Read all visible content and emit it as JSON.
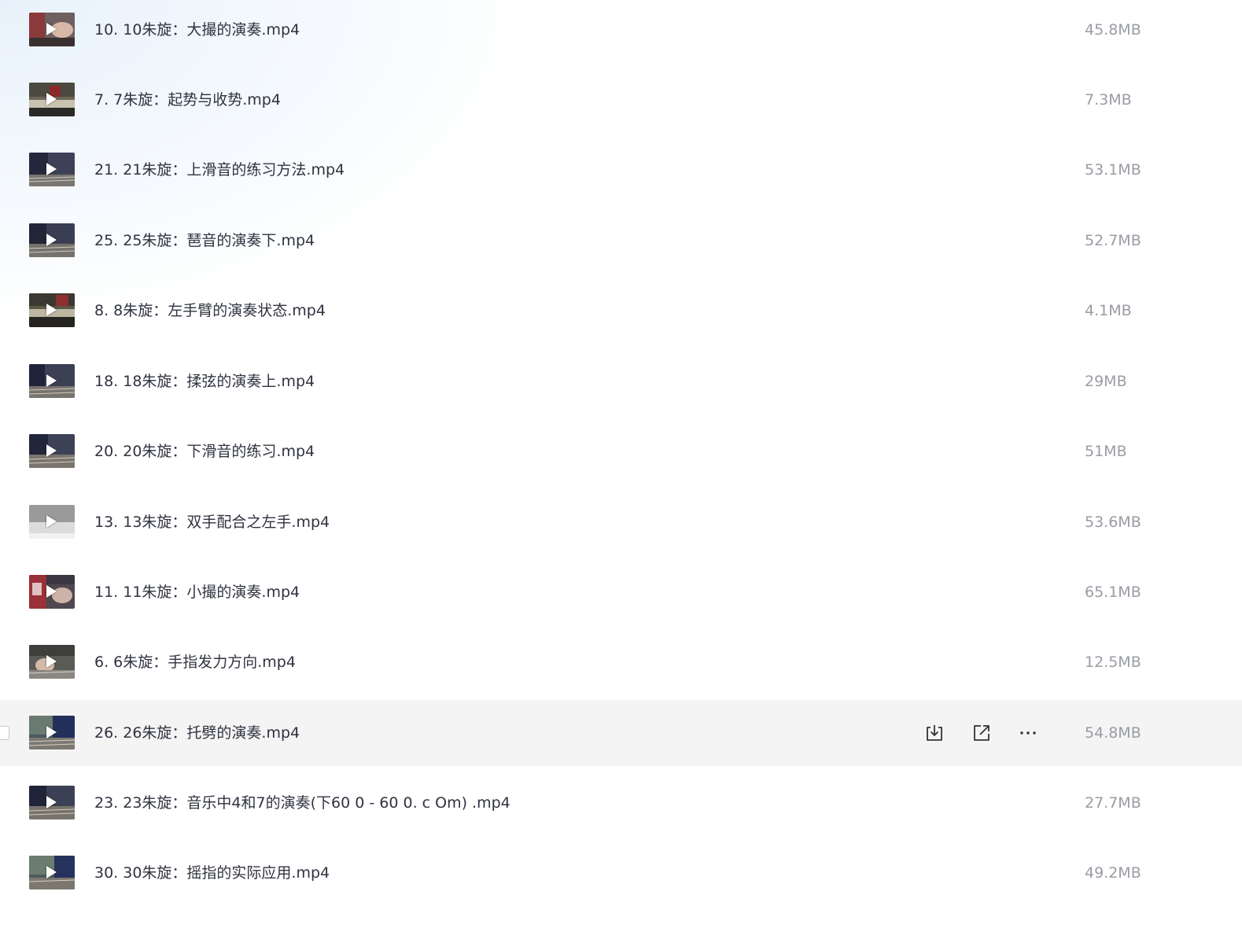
{
  "files": [
    {
      "name": "10. 10朱旋：大撮的演奏.mp4",
      "size": "45.8MB",
      "thumb": "a"
    },
    {
      "name": "7. 7朱旋：起势与收势.mp4",
      "size": "7.3MB",
      "thumb": "b"
    },
    {
      "name": "21. 21朱旋：上滑音的练习方法.mp4",
      "size": "53.1MB",
      "thumb": "c"
    },
    {
      "name": "25. 25朱旋：琶音的演奏下.mp4",
      "size": "52.7MB",
      "thumb": "c"
    },
    {
      "name": "8. 8朱旋：左手臂的演奏状态.mp4",
      "size": "4.1MB",
      "thumb": "d"
    },
    {
      "name": "18. 18朱旋：揉弦的演奏上.mp4",
      "size": "29MB",
      "thumb": "c"
    },
    {
      "name": "20. 20朱旋：下滑音的练习.mp4",
      "size": "51MB",
      "thumb": "c"
    },
    {
      "name": "13. 13朱旋：双手配合之左手.mp4",
      "size": "53.6MB",
      "thumb": "e"
    },
    {
      "name": "11. 11朱旋：小撮的演奏.mp4",
      "size": "65.1MB",
      "thumb": "f"
    },
    {
      "name": "6. 6朱旋：手指发力方向.mp4",
      "size": "12.5MB",
      "thumb": "g"
    },
    {
      "name": "26. 26朱旋：托劈的演奏.mp4",
      "size": "54.8MB",
      "thumb": "h",
      "hovered": true
    },
    {
      "name": "23. 23朱旋：音乐中4和7的演奏(下60 0 - 60 0. c Om) .mp4",
      "size": "27.7MB",
      "thumb": "c"
    },
    {
      "name": "30. 30朱旋：摇指的实际应用.mp4",
      "size": "49.2MB",
      "thumb": "h"
    }
  ],
  "hover_actions": [
    {
      "icon": "download-icon"
    },
    {
      "icon": "share-icon"
    },
    {
      "icon": "more-icon"
    }
  ],
  "colors": {
    "name_text": "#303340",
    "size_text": "#9a9ca4",
    "hover_row": "#f4f4f4",
    "icon": "#333333"
  }
}
